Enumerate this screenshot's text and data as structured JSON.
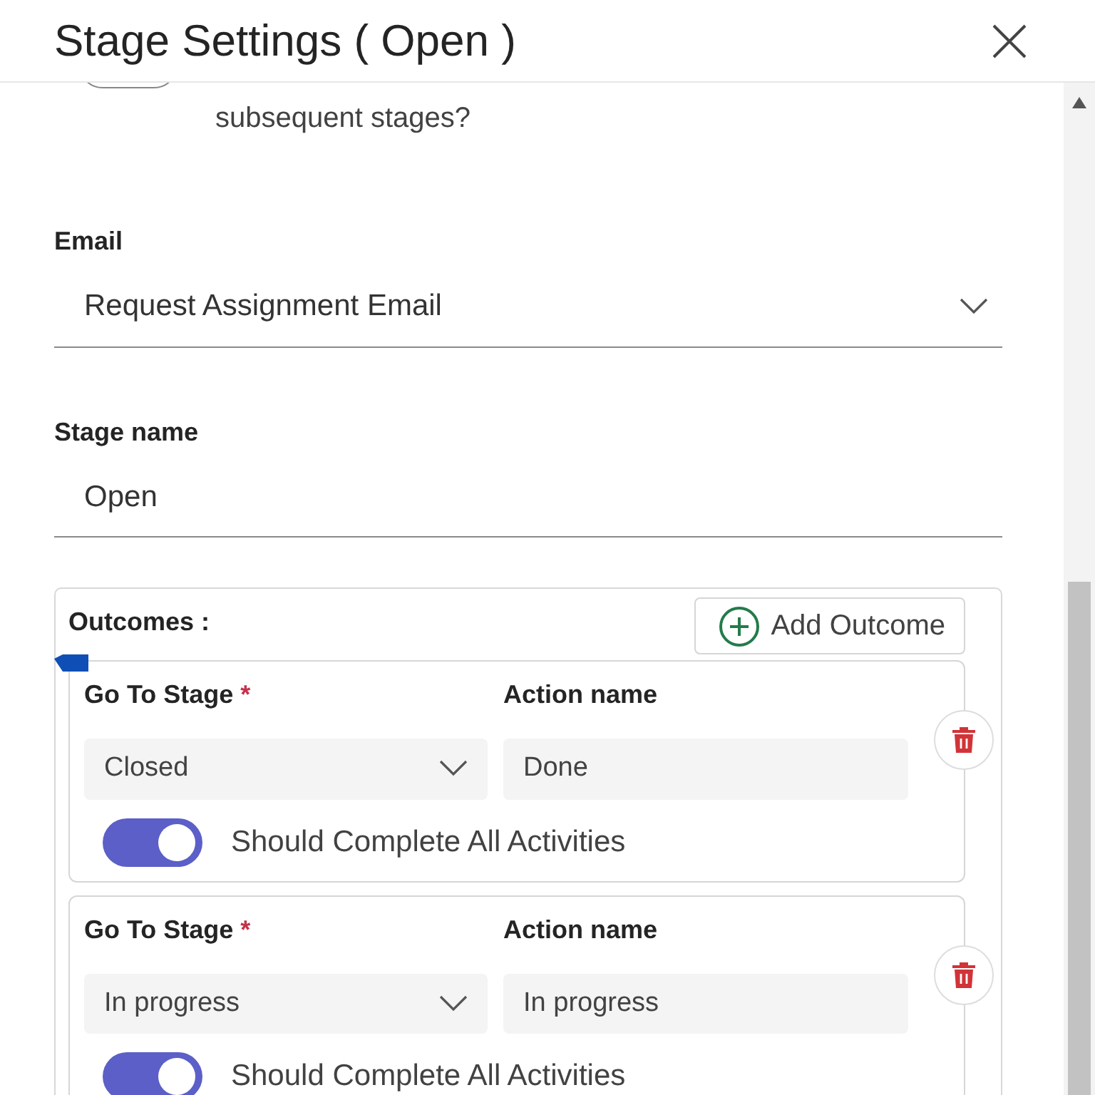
{
  "dialog": {
    "title": "Stage Settings ( Open )"
  },
  "cut_off_option": {
    "text": "subsequent stages?",
    "on": false
  },
  "email": {
    "label": "Email",
    "value": "Request Assignment Email"
  },
  "stage_name": {
    "label": "Stage name",
    "value": "Open"
  },
  "outcomes": {
    "label": "Outcomes :",
    "add_button": "Add Outcome",
    "items": [
      {
        "go_to_label": "Go To Stage",
        "required_mark": "*",
        "go_to_value": "Closed",
        "action_label": "Action name",
        "action_value": "Done",
        "toggle_label": "Should Complete All Activities",
        "on": true
      },
      {
        "go_to_label": "Go To Stage",
        "required_mark": "*",
        "go_to_value": "In progress",
        "action_label": "Action name",
        "action_value": "In progress",
        "toggle_label": "Should Complete All Activities",
        "on": true
      }
    ]
  }
}
